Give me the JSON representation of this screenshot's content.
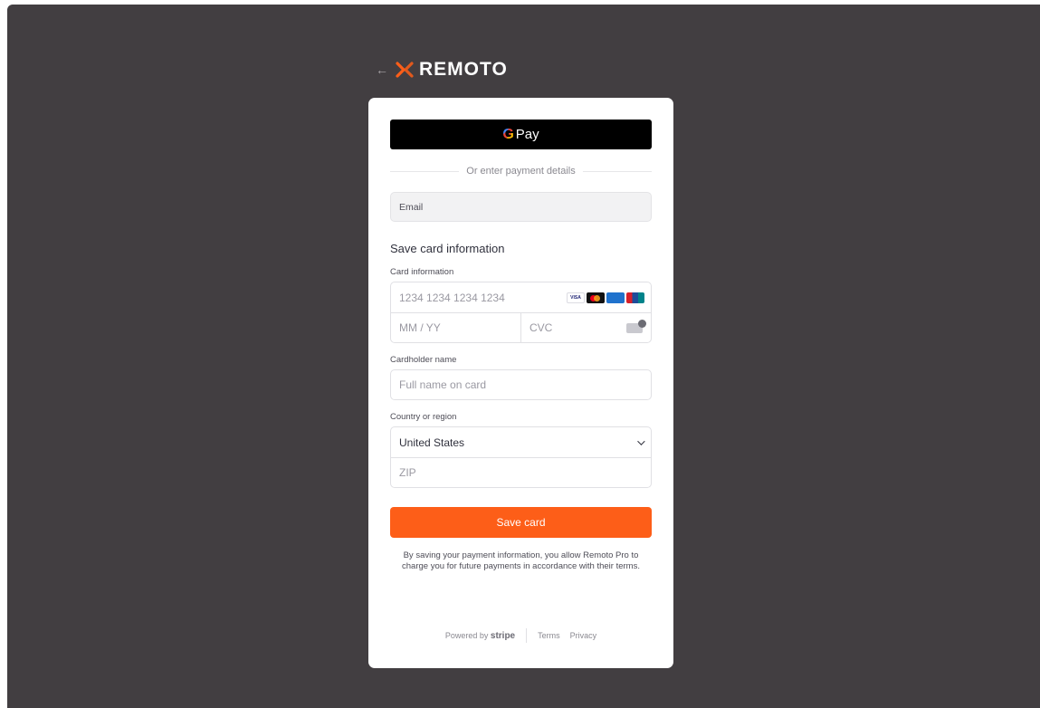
{
  "brand": {
    "back_arrow": "←",
    "name": "REMOTO"
  },
  "gpay": {
    "g": "G",
    "pay": "Pay"
  },
  "divider_text": "Or enter payment details",
  "email": {
    "label": "Email"
  },
  "section_title": "Save card information",
  "card_info": {
    "label": "Card information",
    "number_placeholder": "1234 1234 1234 1234",
    "expiry_placeholder": "MM / YY",
    "cvc_placeholder": "CVC",
    "brands": [
      "VISA",
      "",
      "",
      ""
    ]
  },
  "cardholder": {
    "label": "Cardholder name",
    "placeholder": "Full name on card"
  },
  "country": {
    "label": "Country or region",
    "selected": "United States",
    "zip_placeholder": "ZIP"
  },
  "save_button": "Save card",
  "legal": "By saving your payment information, you allow Remoto Pro to charge you for future payments in accordance with their terms.",
  "footer": {
    "powered_by": "Powered by",
    "stripe": "stripe",
    "terms": "Terms",
    "privacy": "Privacy"
  },
  "colors": {
    "accent": "#fd5e18",
    "backdrop": "#423e41"
  }
}
